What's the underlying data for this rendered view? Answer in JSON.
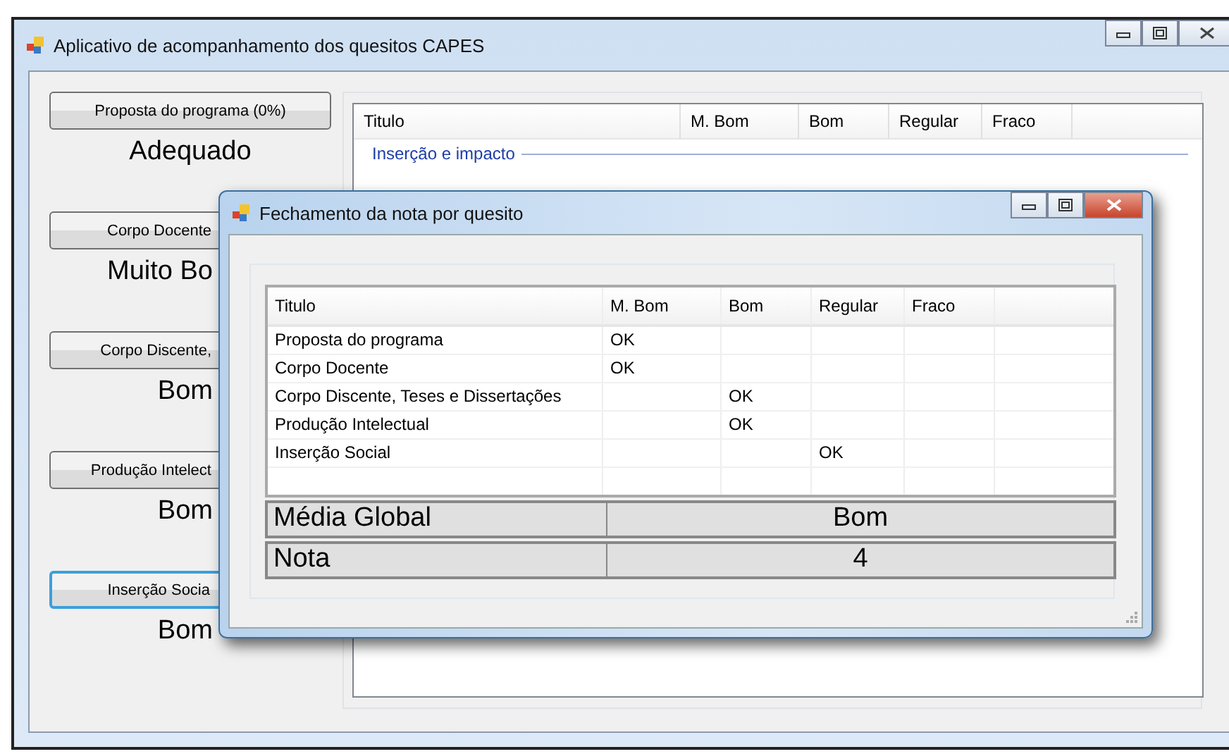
{
  "main_window": {
    "title": "Aplicativo de acompanhamento dos quesitos CAPES",
    "items": [
      {
        "button": "Proposta do programa (0%)",
        "result": "Adequado",
        "focused": false
      },
      {
        "button": "Corpo Docente",
        "result": "Muito Bo",
        "focused": false
      },
      {
        "button": "Corpo Discente,",
        "result": "Bom",
        "focused": false
      },
      {
        "button": "Produção Intelect",
        "result": "Bom",
        "focused": false
      },
      {
        "button": "Inserção Socia",
        "result": "Bom",
        "focused": true
      }
    ],
    "list": {
      "columns": [
        "Titulo",
        "M. Bom",
        "Bom",
        "Regular",
        "Fraco"
      ],
      "group": "Inserção e impacto"
    }
  },
  "dialog": {
    "title": "Fechamento da nota por quesito",
    "columns": [
      "Titulo",
      "M. Bom",
      "Bom",
      "Regular",
      "Fraco"
    ],
    "rows": [
      [
        "Proposta do programa",
        "OK",
        null,
        null,
        null
      ],
      [
        "Corpo Docente",
        "OK",
        null,
        null,
        null
      ],
      [
        "Corpo Discente, Teses e Dissertações",
        null,
        "OK",
        null,
        null
      ],
      [
        "Produção Intelectual",
        null,
        "OK",
        null,
        null
      ],
      [
        "Inserção Social",
        null,
        null,
        "OK",
        null
      ]
    ],
    "summary": [
      {
        "label": "Média Global",
        "value": "Bom"
      },
      {
        "label": "Nota",
        "value": "4"
      }
    ]
  }
}
